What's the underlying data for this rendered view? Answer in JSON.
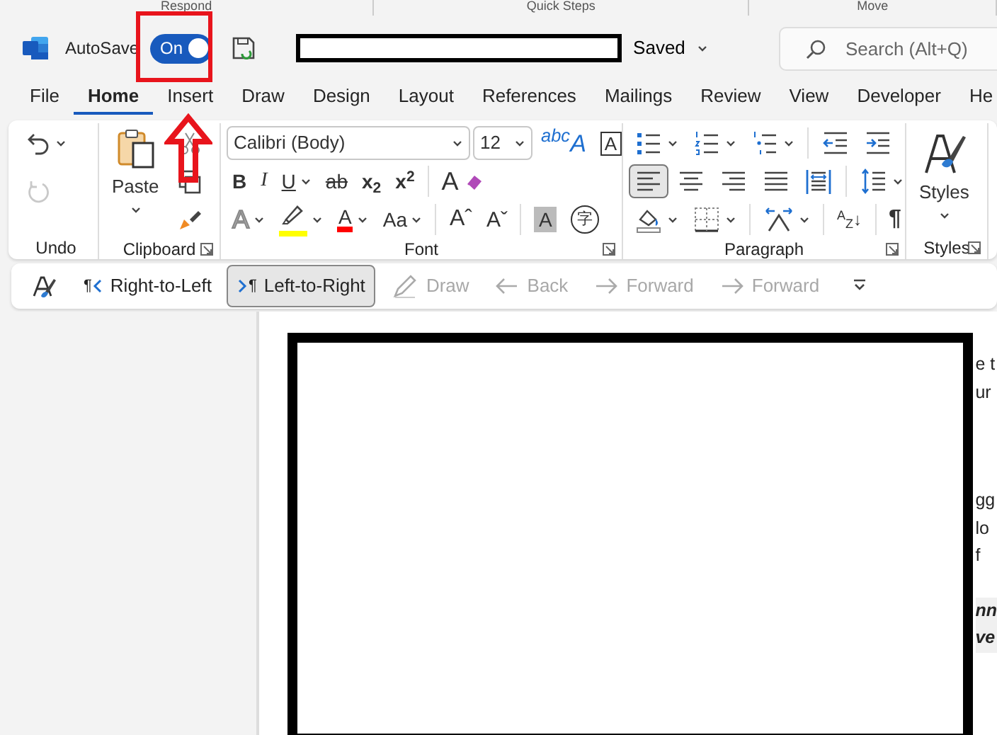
{
  "top_strip": {
    "groups": [
      "Respond",
      "Quick Steps",
      "Move"
    ]
  },
  "title_bar": {
    "autosave_label": "AutoSave",
    "autosave_toggle": {
      "label": "On",
      "on": true
    },
    "save_status": "Saved",
    "search": {
      "placeholder": "Search (Alt+Q)"
    }
  },
  "tabs": [
    {
      "label": "File",
      "selected": false
    },
    {
      "label": "Home",
      "selected": true
    },
    {
      "label": "Insert",
      "selected": false
    },
    {
      "label": "Draw",
      "selected": false
    },
    {
      "label": "Design",
      "selected": false
    },
    {
      "label": "Layout",
      "selected": false
    },
    {
      "label": "References",
      "selected": false
    },
    {
      "label": "Mailings",
      "selected": false
    },
    {
      "label": "Review",
      "selected": false
    },
    {
      "label": "View",
      "selected": false
    },
    {
      "label": "Developer",
      "selected": false
    },
    {
      "label": "He",
      "selected": false
    }
  ],
  "ribbon": {
    "groups": [
      {
        "label": "Undo",
        "launcher": false,
        "parts": [
          {
            "kind": "rows",
            "rows": [
              {
                "controls": [
                  {
                    "kind": "undo",
                    "caret": true,
                    "disabled": false
                  }
                ]
              },
              {
                "controls": [
                  {
                    "kind": "redo",
                    "caret": false,
                    "disabled": true
                  }
                ]
              }
            ]
          }
        ]
      },
      {
        "label": "Clipboard",
        "launcher": true,
        "parts": [
          {
            "kind": "large",
            "control": {
              "kind": "paste",
              "text": "Paste",
              "caret": true
            }
          },
          {
            "kind": "rows",
            "rows": [
              {
                "controls": [
                  {
                    "kind": "cut",
                    "caret": false
                  }
                ]
              },
              {
                "controls": [
                  {
                    "kind": "copy",
                    "caret": false
                  }
                ]
              },
              {
                "controls": [
                  {
                    "kind": "painter",
                    "caret": false
                  }
                ]
              }
            ]
          }
        ]
      },
      {
        "label": "Font",
        "launcher": true,
        "parts": [
          {
            "kind": "rows",
            "rows": [
              {
                "controls": [
                  {
                    "kind": "font-select",
                    "value": "Calibri (Body)"
                  },
                  {
                    "kind": "size-select",
                    "value": "12"
                  },
                  {
                    "kind": "phonetic",
                    "text": "$^{abc}$A",
                    "caret": false
                  },
                  {
                    "kind": "boxed",
                    "text": "A",
                    "caret": false
                  }
                ]
              },
              {
                "controls": [
                  {
                    "kind": "bold",
                    "text": "B",
                    "caret": false
                  },
                  {
                    "kind": "italic",
                    "text": "I",
                    "caret": false
                  },
                  {
                    "kind": "underline",
                    "text": "U",
                    "caret": true
                  },
                  {
                    "kind": "strike",
                    "text": "ab",
                    "caret": false
                  },
                  {
                    "kind": "subscript",
                    "text": "x$_{2}$",
                    "caret": false
                  },
                  {
                    "kind": "superscript",
                    "text": "x$^{2}$",
                    "caret": false
                  },
                  {
                    "kind": "separator"
                  },
                  {
                    "kind": "eraser",
                    "text": "A",
                    "caret": false
                  }
                ]
              },
              {
                "controls": [
                  {
                    "kind": "effects",
                    "text": "A",
                    "caret": true
                  },
                  {
                    "kind": "highlighter",
                    "color": "#ffff00",
                    "caret": true
                  },
                  {
                    "kind": "colorbar",
                    "text": "A",
                    "color": "#ff0000",
                    "caret": true
                  },
                  {
                    "kind": "case",
                    "text": "Aa",
                    "caret": true
                  },
                  {
                    "kind": "separator"
                  },
                  {
                    "kind": "grow",
                    "text": "Aˆ",
                    "caret": false
                  },
                  {
                    "kind": "shrink",
                    "text": "Aˇ",
                    "caret": false
                  },
                  {
                    "kind": "separator"
                  },
                  {
                    "kind": "shaded",
                    "text": "A",
                    "caret": false
                  },
                  {
                    "kind": "circled",
                    "text": "字",
                    "caret": false
                  }
                ]
              }
            ]
          }
        ]
      },
      {
        "label": "Paragraph",
        "launcher": true,
        "parts": [
          {
            "kind": "rows",
            "rows": [
              {
                "controls": [
                  {
                    "kind": "bullets",
                    "caret": true
                  },
                  {
                    "kind": "numbering",
                    "caret": true
                  },
                  {
                    "kind": "multilevel",
                    "caret": true
                  },
                  {
                    "kind": "separator"
                  },
                  {
                    "kind": "outdent",
                    "caret": false
                  },
                  {
                    "kind": "indent",
                    "caret": false
                  }
                ]
              },
              {
                "controls": [
                  {
                    "kind": "align-left",
                    "caret": false,
                    "selected": true
                  },
                  {
                    "kind": "align-center",
                    "caret": false,
                    "selected": false
                  },
                  {
                    "kind": "align-right",
                    "caret": false,
                    "selected": false
                  },
                  {
                    "kind": "justify",
                    "caret": false,
                    "selected": false
                  },
                  {
                    "kind": "distributed",
                    "caret": false,
                    "selected": false
                  },
                  {
                    "kind": "separator"
                  },
                  {
                    "kind": "line-spacing",
                    "caret": true
                  }
                ]
              },
              {
                "controls": [
                  {
                    "kind": "shading",
                    "caret": true
                  },
                  {
                    "kind": "borders",
                    "caret": true
                  },
                  {
                    "kind": "separator"
                  },
                  {
                    "kind": "text-direction",
                    "caret": true
                  },
                  {
                    "kind": "separator"
                  },
                  {
                    "kind": "sort",
                    "text": "$^{A}$$_{Z}$↓",
                    "caret": false
                  },
                  {
                    "kind": "separator"
                  },
                  {
                    "kind": "pilcrow",
                    "text": "¶",
                    "caret": false
                  }
                ]
              }
            ]
          }
        ]
      },
      {
        "label": "Styles",
        "launcher": true,
        "parts": [
          {
            "kind": "large",
            "control": {
              "kind": "styles",
              "text": "Styles",
              "caret": true
            }
          }
        ]
      }
    ]
  },
  "toolbar": [
    {
      "kind": "style-pen"
    },
    {
      "kind": "rtl",
      "glyph": "¶",
      "label": "Right-to-Left",
      "selected": false,
      "disabled": false
    },
    {
      "kind": "ltr",
      "glyph": "¶",
      "label": "Left-to-Right",
      "selected": true,
      "disabled": false
    },
    {
      "kind": "draw",
      "label": "Draw",
      "selected": false,
      "disabled": true
    },
    {
      "kind": "back",
      "label": "Back",
      "selected": false,
      "disabled": true
    },
    {
      "kind": "forward",
      "label": "Forward",
      "selected": false,
      "disabled": true
    },
    {
      "kind": "forward",
      "label": "Forward",
      "selected": false,
      "disabled": true
    },
    {
      "kind": "overflow"
    }
  ],
  "document": {
    "paragraphs": [
      {
        "lines": [
          "e t",
          "ur"
        ],
        "emphasis": false
      },
      {
        "lines": [
          "gg",
          "lo",
          "f"
        ],
        "emphasis": false
      },
      {
        "lines": [
          "nn",
          "ve"
        ],
        "emphasis": true
      }
    ]
  }
}
